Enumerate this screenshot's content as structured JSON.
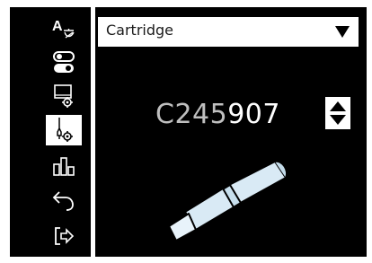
{
  "sidebar": {
    "items": [
      {
        "icon": "language-icon",
        "active": false
      },
      {
        "icon": "toggle-switches-icon",
        "active": false
      },
      {
        "icon": "station-settings-icon",
        "active": false
      },
      {
        "icon": "tool-settings-icon",
        "active": true
      },
      {
        "icon": "bar-chart-icon",
        "active": false
      },
      {
        "icon": "back-arrow-icon",
        "active": false
      },
      {
        "icon": "exit-icon",
        "active": false
      }
    ]
  },
  "dropdown": {
    "label": "Cartridge",
    "arrow": "▼"
  },
  "cartridge": {
    "code_prefix": "C245",
    "code_suffix": "907"
  },
  "colors": {
    "background": "#000000",
    "foreground": "#ffffff",
    "muted_text": "#bfbfbf",
    "tip": "#d9eaf5"
  }
}
